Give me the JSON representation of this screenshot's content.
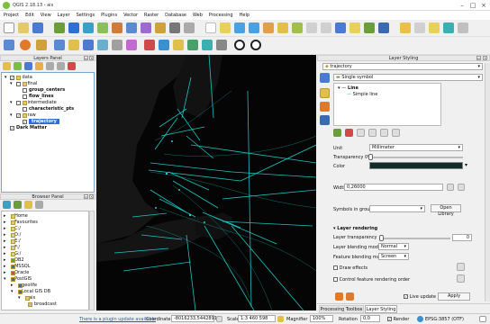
{
  "window": {
    "title": "QGIS 2.18.13 - ais"
  },
  "menu": [
    "Project",
    "Edit",
    "View",
    "Layer",
    "Settings",
    "Plugins",
    "Vector",
    "Raster",
    "Database",
    "Web",
    "Processing",
    "Help"
  ],
  "layers_panel": {
    "title": "Layers Panel",
    "items": [
      {
        "label": "data",
        "level": 0,
        "bold": false
      },
      {
        "label": "final",
        "level": 1,
        "bold": false
      },
      {
        "label": "group_centers",
        "level": 2,
        "bold": true
      },
      {
        "label": "flow_lines",
        "level": 2,
        "bold": true
      },
      {
        "label": "intermediate",
        "level": 1,
        "bold": false
      },
      {
        "label": "characteristic_pts",
        "level": 2,
        "bold": true
      },
      {
        "label": "raw",
        "level": 1,
        "bold": false
      },
      {
        "label": "trajectory",
        "level": 2,
        "bold": true,
        "selected": true
      },
      {
        "label": "Dark Matter",
        "level": 0,
        "bold": true
      }
    ]
  },
  "browser_panel": {
    "title": "Browser Panel",
    "items": [
      {
        "label": "Home",
        "level": 0
      },
      {
        "label": "Favourites",
        "level": 0
      },
      {
        "label": "C:/",
        "level": 0
      },
      {
        "label": "D:/",
        "level": 0
      },
      {
        "label": "E:/",
        "level": 0
      },
      {
        "label": "F:/",
        "level": 0
      },
      {
        "label": "G:/",
        "level": 0
      },
      {
        "label": "DB2",
        "level": 0
      },
      {
        "label": "MSSQL",
        "level": 0
      },
      {
        "label": "Oracle",
        "level": 0
      },
      {
        "label": "PostGIS",
        "level": 0
      },
      {
        "label": "geolife",
        "level": 1
      },
      {
        "label": "Local GIS DB",
        "level": 1
      },
      {
        "label": "ais",
        "level": 2
      },
      {
        "label": "broadcast",
        "level": 3
      }
    ]
  },
  "styling": {
    "title": "Layer Styling",
    "layer": "trajectory",
    "renderer": "Single symbol",
    "symbol_tree": [
      "Line",
      "Simple line"
    ],
    "unit_label": "Unit",
    "unit_value": "Millimeter",
    "transparency_label": "Transparency 0%",
    "color_label": "Color",
    "color_value": "#0f2b2a",
    "width_label": "Width",
    "width_value": "0,26000",
    "symbols_label": "Symbols in group",
    "open_library": "Open Library",
    "layer_rendering": "Layer rendering",
    "layer_transparency_label": "Layer transparency",
    "layer_transparency_value": "0",
    "layer_blend_label": "Layer blending mode",
    "layer_blend_value": "Normal",
    "feature_blend_label": "Feature blending mode",
    "feature_blend_value": "Screen",
    "draw_effects": "Draw effects",
    "control_order": "Control feature rendering order",
    "live_update": "Live update",
    "apply": "Apply",
    "tabs": [
      "Processing Toolbox",
      "Layer Styling"
    ]
  },
  "status": {
    "update": "There is a plugin update available",
    "coordinate_label": "Coordinate",
    "coordinate_value": "-8016233,5442891",
    "scale_label": "Scale",
    "scale_value": "1:3 460 598",
    "magnifier_label": "Magnifier",
    "magnifier_value": "100%",
    "rotation_label": "Rotation",
    "rotation_value": "0,0",
    "render_label": "Render",
    "crs": "EPSG:3857 (OTF)"
  },
  "colors": {
    "accent": "#2f6fd3",
    "map_bg": "#050505",
    "track": "#19e6e0"
  }
}
